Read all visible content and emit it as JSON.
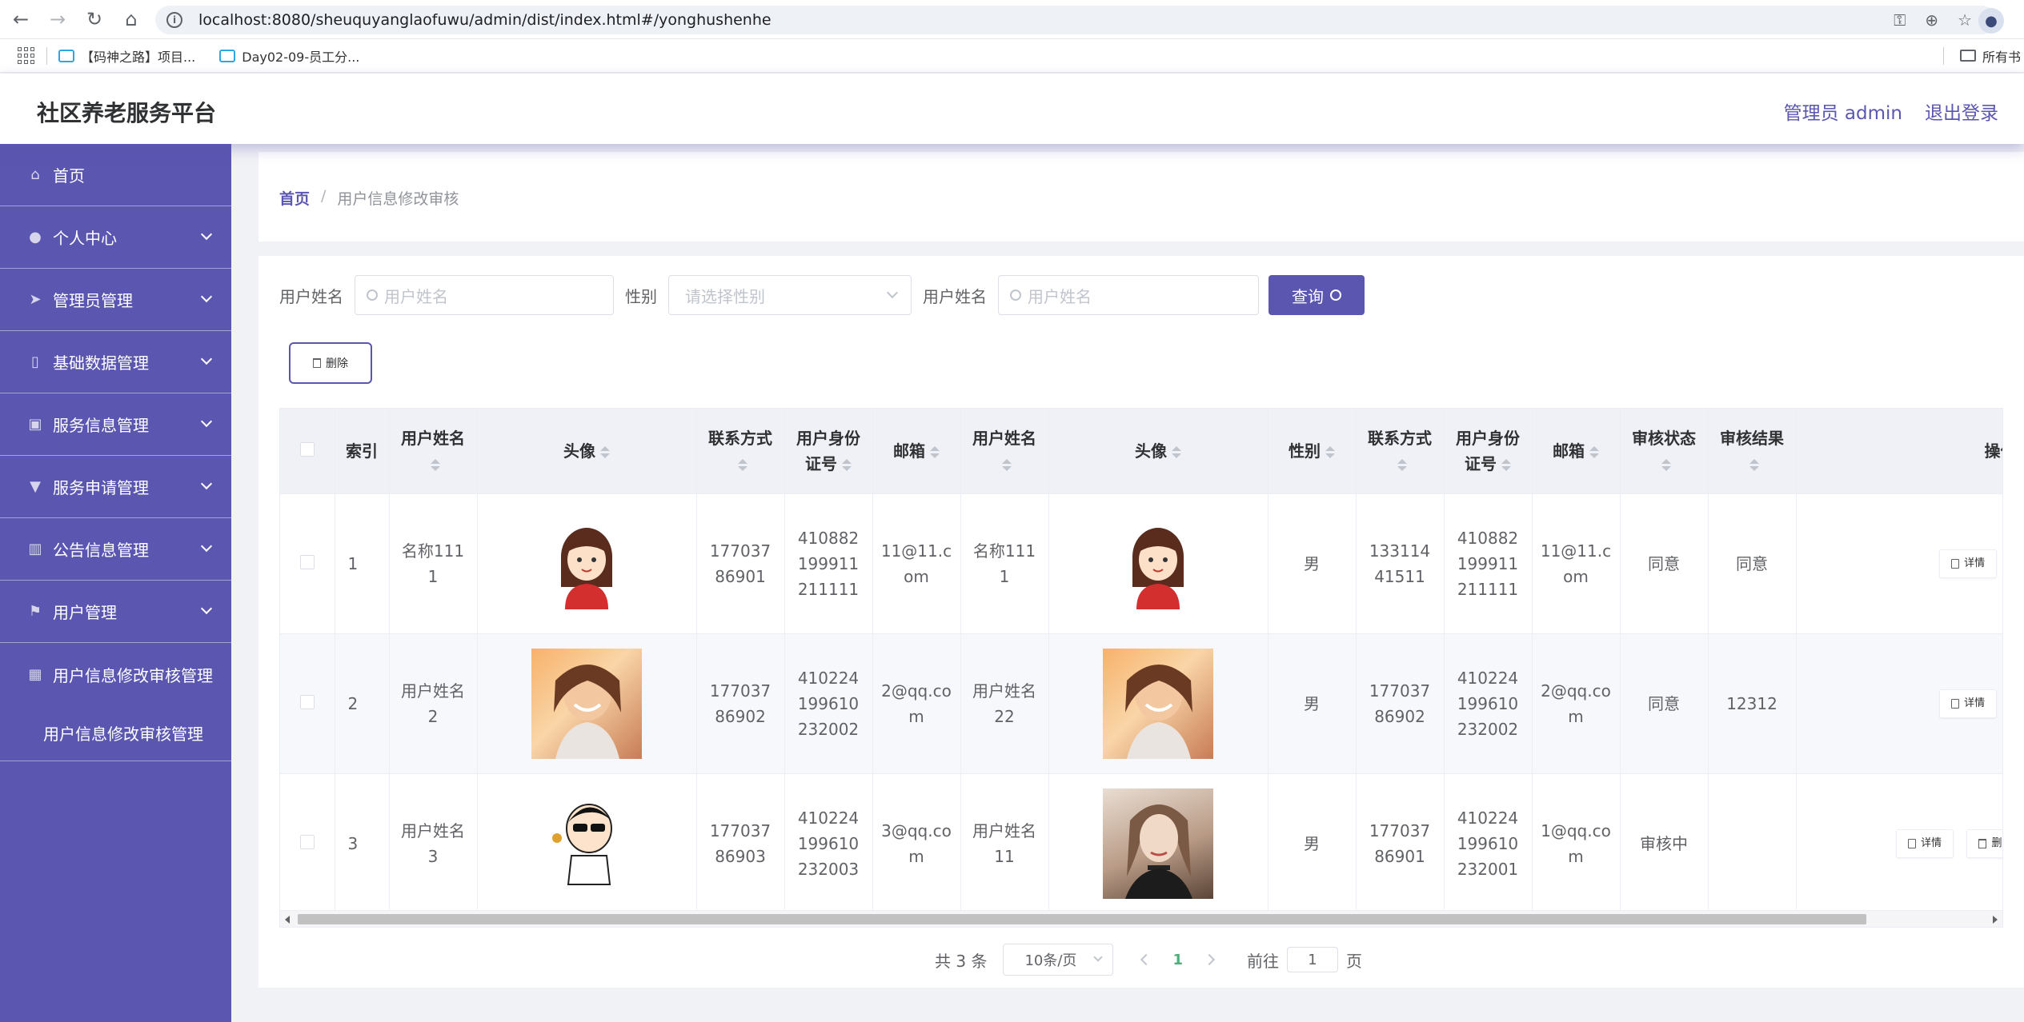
{
  "browser": {
    "url": "localhost:8080/sheuquyanglaofuwu/admin/dist/index.html#/yonghushenhe",
    "bookmarks": [
      "【码神之路】项目...",
      "Day02-09-员工分..."
    ],
    "all_bookmarks": "所有书"
  },
  "header": {
    "title": "社区养老服务平台",
    "admin": "管理员 admin",
    "logout": "退出登录"
  },
  "sidebar": {
    "items": [
      {
        "label": "首页",
        "icon": "home-icon"
      },
      {
        "label": "个人中心",
        "icon": "user-icon"
      },
      {
        "label": "管理员管理",
        "icon": "send-icon"
      },
      {
        "label": "基础数据管理",
        "icon": "phone-icon"
      },
      {
        "label": "服务信息管理",
        "icon": "briefcase-icon"
      },
      {
        "label": "服务申请管理",
        "icon": "stamp-icon"
      },
      {
        "label": "公告信息管理",
        "icon": "chart-icon"
      },
      {
        "label": "用户管理",
        "icon": "flag-icon"
      },
      {
        "label": "用户信息修改审核管理",
        "icon": "grid-icon"
      }
    ],
    "subitem": "用户信息修改审核管理"
  },
  "breadcrumb": {
    "home": "首页",
    "separator": "/",
    "current": "用户信息修改审核"
  },
  "search": {
    "name_label": "用户姓名",
    "name_placeholder": "用户姓名",
    "gender_label": "性别",
    "gender_placeholder": "请选择性别",
    "name2_label": "用户姓名",
    "name2_placeholder": "用户姓名",
    "button": "查询"
  },
  "toolbar": {
    "delete_label": "删除"
  },
  "table": {
    "headers": {
      "index": "索引",
      "name": "用户姓名",
      "avatar": "头像",
      "contact": "联系方式",
      "idcard": "用户身份证号",
      "email": "邮箱",
      "name2": "用户姓名",
      "avatar2": "头像",
      "gender": "性别",
      "contact2": "联系方式",
      "idcard2": "用户身份证号",
      "email2": "邮箱",
      "status": "审核状态",
      "result": "审核结果",
      "ops": "操作"
    },
    "rows": [
      {
        "index": "1",
        "name": "名称1111",
        "contact": "17703786901",
        "idcard": "410882199911211111",
        "email": "11@11.com",
        "name2": "名称1111",
        "gender": "男",
        "contact2": "13311441511",
        "idcard2": "410882199911211111",
        "email2": "11@11.com",
        "status": "同意",
        "result": "同意",
        "avatar": "cartoon-girl",
        "avatar2": "cartoon-girl"
      },
      {
        "index": "2",
        "name": "用户姓名2",
        "contact": "17703786902",
        "idcard": "410224199610232002",
        "email": "2@qq.com",
        "name2": "用户姓名22",
        "gender": "男",
        "contact2": "17703786902",
        "idcard2": "410224199610232002",
        "email2": "2@qq.com",
        "status": "同意",
        "result": "12312",
        "avatar": "photo-girl",
        "avatar2": "photo-girl"
      },
      {
        "index": "3",
        "name": "用户姓名3",
        "contact": "17703786903",
        "idcard": "410224199610232003",
        "email": "3@qq.com",
        "name2": "用户姓名11",
        "gender": "男",
        "contact2": "17703786901",
        "idcard2": "410224199610232001",
        "email2": "1@qq.com",
        "status": "审核中",
        "result": "",
        "avatar": "cartoon-boy",
        "avatar2": "photo-woman"
      }
    ],
    "detail_label": "详情",
    "delete_label": "删除"
  },
  "pagination": {
    "total": "共 3 条",
    "page_size": "10条/页",
    "current_page": "1",
    "goto_label": "前往",
    "goto_value": "1",
    "page_suffix": "页"
  }
}
